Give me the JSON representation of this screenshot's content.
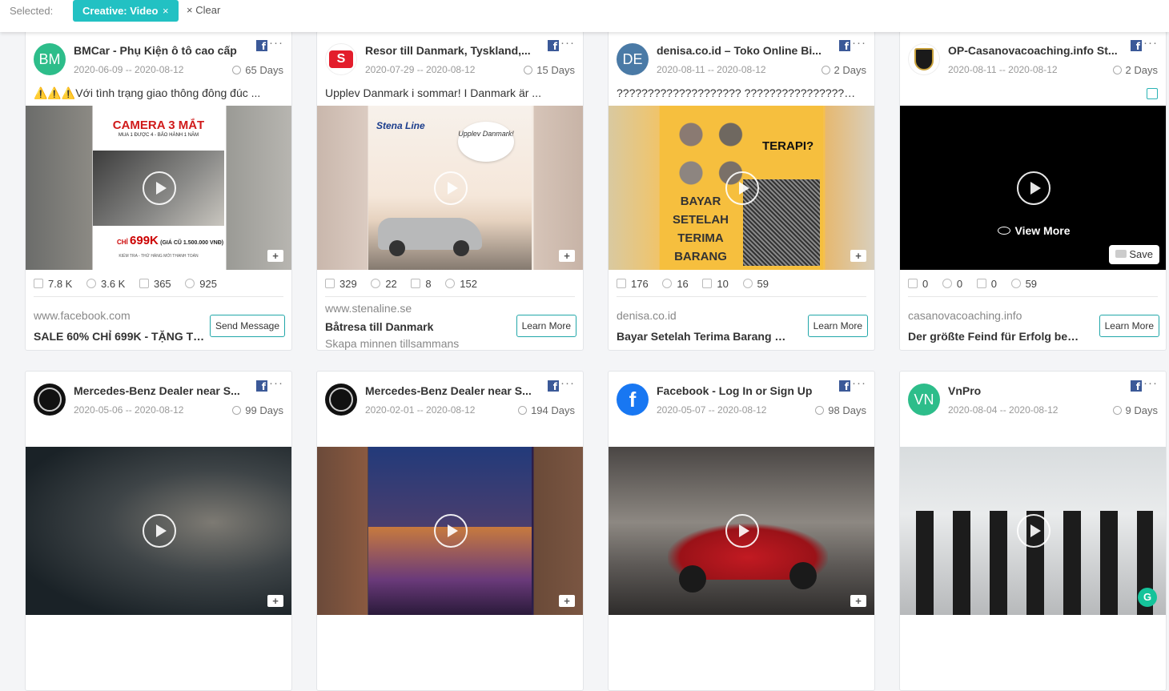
{
  "filter_bar": {
    "selected_label": "Selected:",
    "chip_label": "Creative: Video",
    "chip_remove": "×",
    "clear_label": "× Clear"
  },
  "icons": {
    "facebook": "facebook-badge-icon",
    "more": "more-dots-icon",
    "clock": "clock-icon",
    "play": "play-icon",
    "add_to_folder": "add-to-folder-icon",
    "like": "like-icon",
    "comment": "comment-icon",
    "share": "share-icon",
    "view": "view-icon",
    "eye": "eye-icon",
    "copy": "copy-icon"
  },
  "colors": {
    "accent": "#22c1c3",
    "facebook": "#3b5998"
  },
  "cards": [
    {
      "avatar": "BM",
      "advertiser": "BMCar - Phụ Kiện ô tô cao cấp",
      "dates": "2020-06-09 -- 2020-08-12",
      "days": "65 Days",
      "ad_text": "⚠️⚠️⚠️Với tình trạng giao thông đông đúc ...",
      "likes": "7.8 K",
      "comments": "3.6 K",
      "shares": "365",
      "views": "925",
      "domain": "www.facebook.com",
      "headline": "SALE 60% CHỈ 699K - TẶNG TH...",
      "cta": "Send Message"
    },
    {
      "avatar": "S",
      "advertiser": "Resor till Danmark, Tyskland,...",
      "dates": "2020-07-29 -- 2020-08-12",
      "days": "15 Days",
      "ad_text": "Upplev Danmark i sommar! I Danmark är ...",
      "likes": "329",
      "comments": "22",
      "shares": "8",
      "views": "152",
      "domain": "www.stenaline.se",
      "headline": "Båtresa till Danmark",
      "description": "Skapa minnen tillsammans",
      "cta": "Learn More"
    },
    {
      "avatar": "DE",
      "advertiser": "denisa.co.id – Toko Online Bi...",
      "dates": "2020-08-11 -- 2020-08-12",
      "days": "2 Days",
      "ad_text": "???????????????????? ????????????????..????????...",
      "likes": "176",
      "comments": "16",
      "shares": "10",
      "views": "59",
      "domain": "denisa.co.id",
      "headline": "Bayar Setelah Terima Barang + ...",
      "cta": "Learn More"
    },
    {
      "avatar": "",
      "advertiser": "OP-Casanovacoaching.info St...",
      "dates": "2020-08-11 -- 2020-08-12",
      "days": "2 Days",
      "likes": "0",
      "comments": "0",
      "shares": "0",
      "views": "59",
      "domain": "casanovacoaching.info",
      "headline": "Der größte Feind für Erfolg bei ...",
      "cta": "Learn More",
      "view_more": "View More",
      "save": "Save"
    },
    {
      "avatar": "",
      "advertiser": "Mercedes-Benz Dealer near S...",
      "dates": "2020-05-06 -- 2020-08-12",
      "days": "99 Days"
    },
    {
      "avatar": "",
      "advertiser": "Mercedes-Benz Dealer near S...",
      "dates": "2020-02-01 -- 2020-08-12",
      "days": "194 Days"
    },
    {
      "avatar": "f",
      "advertiser": "Facebook - Log In or Sign Up",
      "dates": "2020-05-07 -- 2020-08-12",
      "days": "98 Days"
    },
    {
      "avatar": "VN",
      "advertiser": "VnPro",
      "dates": "2020-08-04 -- 2020-08-12",
      "days": "9 Days"
    }
  ],
  "creative_text": {
    "camera_title": "CAMERA 3 MẮT",
    "camera_sub": "MUA 1 ĐƯỢC 4 - BẢO HÀNH 1 NĂM",
    "camera_price_prefix": "CHỈ",
    "camera_price": "699K",
    "camera_price_note": "(GIÁ CŨ 1.500.000 VNĐ)",
    "camera_footer": "KIỂM TRA - THỬ HÀNG MỚI THANH TOÁN",
    "stena_logo": "Stena Line",
    "stena_bubble": "Upplev Danmark!",
    "denisa_terapi": "TERAPI?",
    "denisa_line1": "BAYAR",
    "denisa_line2": "SETELAH",
    "denisa_line3": "TERIMA",
    "denisa_line4": "BARANG"
  }
}
